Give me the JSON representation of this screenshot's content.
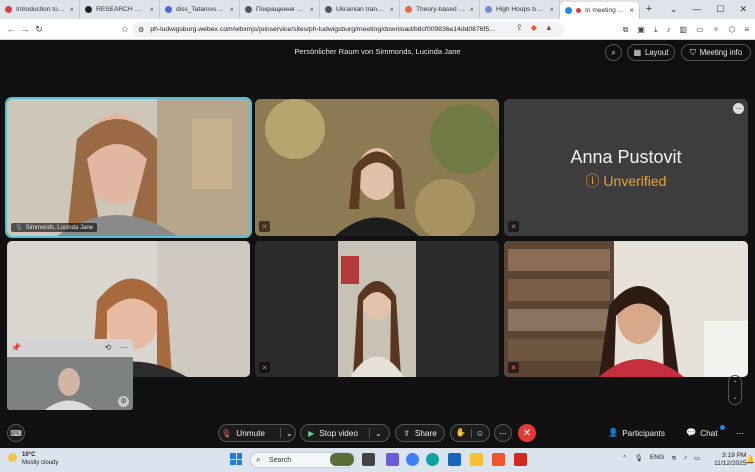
{
  "browser": {
    "tabs": [
      {
        "label": "Introduction to note-t",
        "color": "#d64242"
      },
      {
        "label": "RESEARCH GROUP LI",
        "color": "#222222"
      },
      {
        "label": "diss_Tatarovska.pdf",
        "color": "#4a6bd8"
      },
      {
        "label": "Покращення плану д",
        "color": "#555555"
      },
      {
        "label": "Ukrainian translation",
        "color": "#555555"
      },
      {
        "label": "Theory-based exerci",
        "color": "#e56a3a"
      },
      {
        "label": "High Hoops by Tanm",
        "color": "#6f8ad6"
      },
      {
        "label": "In meeting - W",
        "color": "#1e88e5"
      }
    ],
    "new_tab": "+",
    "url": "ph-ludwigsburg.webex.com/wbxmjs/joinservice/sites/ph-ludwigsburg/meeting/download/b8cf009836e14dd0876f5..."
  },
  "meeting": {
    "room_title": "Persönlicher Raum von Simmonds, Lucinda Jane",
    "layout_label": "Layout",
    "info_label": "Meeting info",
    "participants": [
      {
        "name": "Simmonds, Lucinda Jane"
      },
      {
        "name": ""
      },
      {
        "name": "Anna Pustovit",
        "status": "Unverified"
      },
      {
        "name": ""
      },
      {
        "name": ""
      },
      {
        "name": ""
      }
    ]
  },
  "controls": {
    "unmute": "Unmute",
    "stop_video": "Stop video",
    "share": "Share",
    "participants": "Participants",
    "chat": "Chat"
  },
  "taskbar": {
    "weather_temp": "10°C",
    "weather_desc": "Mostly cloudy",
    "search_placeholder": "Search",
    "lang": "ENG",
    "time": "3:19 PM",
    "date": "11/12/2025"
  },
  "colors": {
    "accent": "#4fc3d9",
    "end_call": "#e53935",
    "unverified": "#f0a52e"
  }
}
